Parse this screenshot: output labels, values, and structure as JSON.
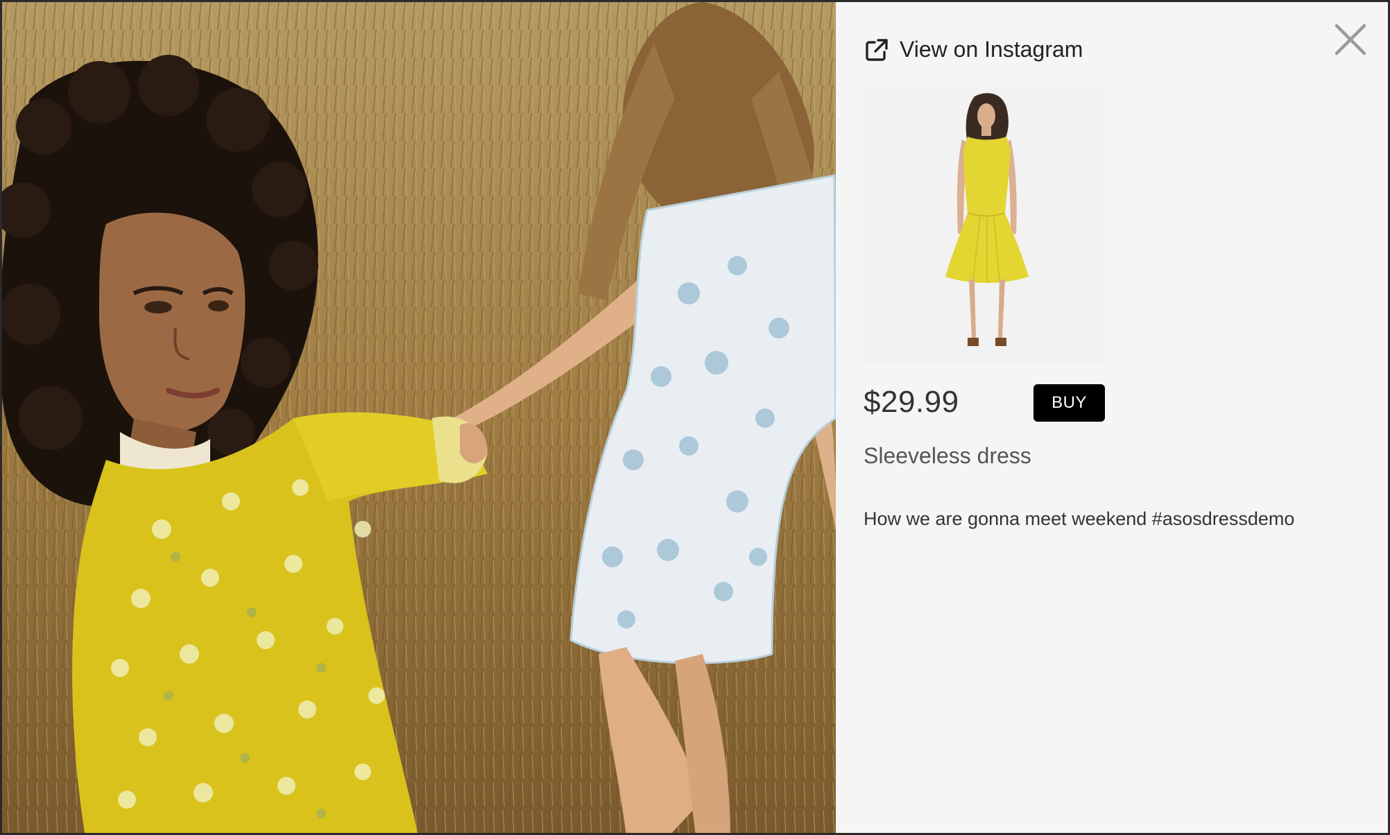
{
  "modal": {
    "external_link_label": "View on Instagram",
    "close_icon": "close-icon",
    "link_icon": "external-link-icon"
  },
  "product": {
    "image_alt": "Yellow sleeveless dress on model",
    "price": "$29.99",
    "buy_label": "BUY",
    "name": "Sleeveless dress"
  },
  "post": {
    "caption": "How we are gonna meet weekend #asosdressdemo"
  },
  "colors": {
    "buy_button": "#000000",
    "panel_background": "#f5f5f5",
    "dress_yellow": "#e6d62a"
  }
}
